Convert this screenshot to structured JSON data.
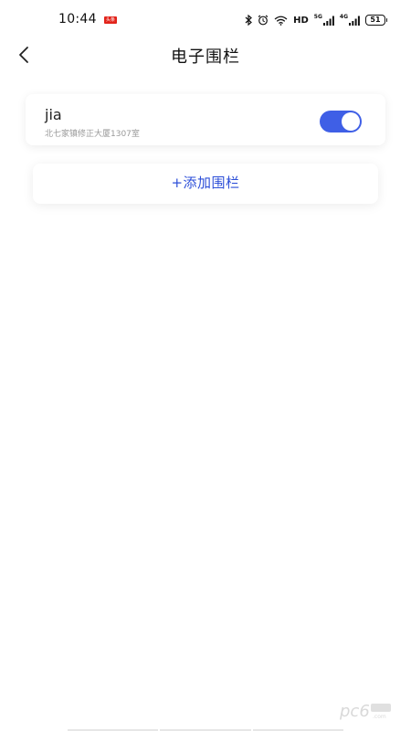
{
  "status_bar": {
    "time": "10:44",
    "notification_badge": "头条",
    "hd_label": "HD",
    "signal1_label": "5G",
    "signal2_label": "4G",
    "battery": "51"
  },
  "nav": {
    "title": "电子围栏"
  },
  "fences": [
    {
      "name": "jia",
      "address": "北七家镇修正大厦1307室",
      "enabled": true
    }
  ],
  "add_fence_label": "+添加围栏",
  "colors": {
    "accent": "#3f5fe6",
    "link": "#2d4fd8"
  },
  "watermark_text": "pc6.com"
}
